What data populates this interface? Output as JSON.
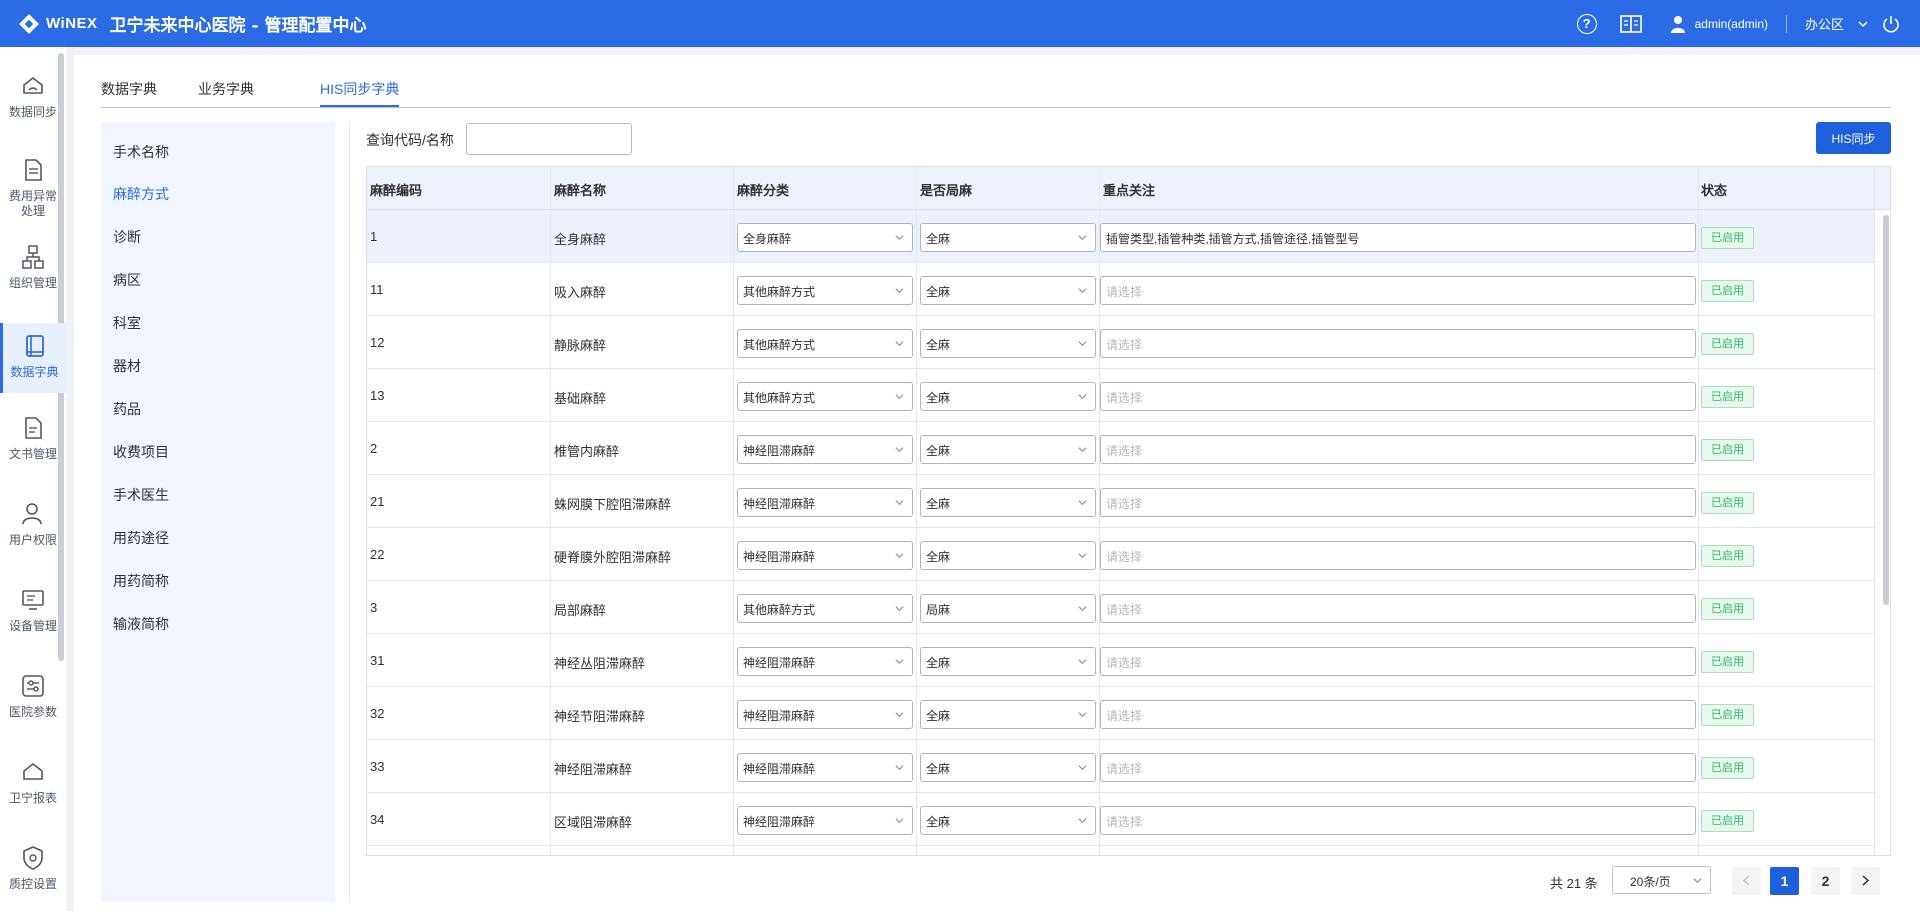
{
  "header": {
    "brand": "WiNEX",
    "title": "卫宁未来中心医院 - 管理配置中心",
    "user": "admin(admin)",
    "area": "办公区"
  },
  "sidebar": {
    "items": [
      {
        "label": "数据同步"
      },
      {
        "label": "费用异常处理"
      },
      {
        "label": "组织管理"
      },
      {
        "label": "数据字典"
      },
      {
        "label": "文书管理"
      },
      {
        "label": "用户权限"
      },
      {
        "label": "设备管理"
      },
      {
        "label": "医院参数"
      },
      {
        "label": "卫宁报表"
      },
      {
        "label": "质控设置"
      }
    ]
  },
  "tabs": [
    "数据字典",
    "业务字典",
    "HIS同步字典"
  ],
  "dict_list": [
    "手术名称",
    "麻醉方式",
    "诊断",
    "病区",
    "科室",
    "器材",
    "药品",
    "收费项目",
    "手术医生",
    "用药途径",
    "用药简称",
    "输液简称"
  ],
  "search": {
    "label": "查询代码/名称",
    "value": ""
  },
  "his_button": "HIS同步",
  "table": {
    "headers": [
      "麻醉编码",
      "麻醉名称",
      "麻醉分类",
      "是否局麻",
      "重点关注",
      "状态"
    ],
    "placeholder": "请选择",
    "rows": [
      {
        "code": "1",
        "name": "全身麻醉",
        "category": "全身麻醉",
        "local": "全麻",
        "focus": "插管类型,插管种类,插管方式,插管途径,插管型号",
        "status": "已启用"
      },
      {
        "code": "11",
        "name": "吸入麻醉",
        "category": "其他麻醉方式",
        "local": "全麻",
        "focus": "",
        "status": "已启用"
      },
      {
        "code": "12",
        "name": "静脉麻醉",
        "category": "其他麻醉方式",
        "local": "全麻",
        "focus": "",
        "status": "已启用"
      },
      {
        "code": "13",
        "name": "基础麻醉",
        "category": "其他麻醉方式",
        "local": "全麻",
        "focus": "",
        "status": "已启用"
      },
      {
        "code": "2",
        "name": "椎管内麻醉",
        "category": "神经阻滞麻醉",
        "local": "全麻",
        "focus": "",
        "status": "已启用"
      },
      {
        "code": "21",
        "name": "蛛网膜下腔阻滞麻醉",
        "category": "神经阻滞麻醉",
        "local": "全麻",
        "focus": "",
        "status": "已启用"
      },
      {
        "code": "22",
        "name": "硬脊膜外腔阻滞麻醉",
        "category": "神经阻滞麻醉",
        "local": "全麻",
        "focus": "",
        "status": "已启用"
      },
      {
        "code": "3",
        "name": "局部麻醉",
        "category": "其他麻醉方式",
        "local": "局麻",
        "focus": "",
        "status": "已启用"
      },
      {
        "code": "31",
        "name": "神经丛阻滞麻醉",
        "category": "神经阻滞麻醉",
        "local": "全麻",
        "focus": "",
        "status": "已启用"
      },
      {
        "code": "32",
        "name": "神经节阻滞麻醉",
        "category": "神经阻滞麻醉",
        "local": "全麻",
        "focus": "",
        "status": "已启用"
      },
      {
        "code": "33",
        "name": "神经阻滞麻醉",
        "category": "神经阻滞麻醉",
        "local": "全麻",
        "focus": "",
        "status": "已启用"
      },
      {
        "code": "34",
        "name": "区域阻滞麻醉",
        "category": "神经阻滞麻醉",
        "local": "全麻",
        "focus": "",
        "status": "已启用"
      }
    ]
  },
  "pagination": {
    "total": "共 21 条",
    "page_size": "20条/页",
    "pages": [
      "1",
      "2"
    ]
  }
}
